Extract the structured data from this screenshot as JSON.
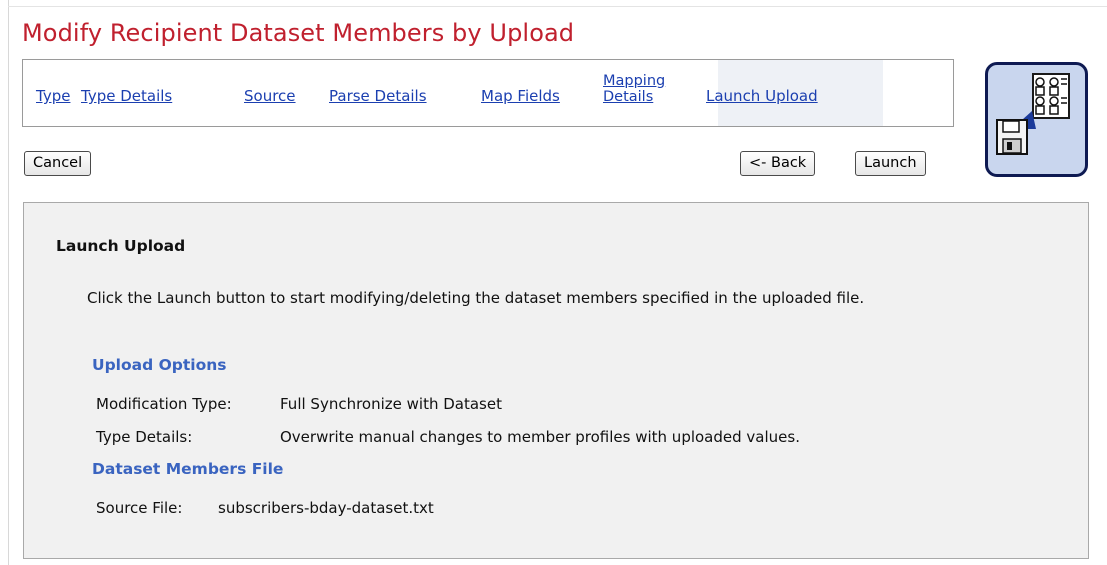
{
  "page": {
    "title": "Modify Recipient Dataset Members by Upload"
  },
  "wizard": {
    "steps": [
      {
        "label": "Type"
      },
      {
        "label": "Type Details"
      },
      {
        "label": "Source"
      },
      {
        "label": "Parse Details"
      },
      {
        "label": "Map Fields"
      },
      {
        "label_line1": "Mapping",
        "label_line2": "Details"
      },
      {
        "label": "Launch Upload",
        "current": true
      }
    ],
    "icon": "upload-members-icon"
  },
  "toolbar": {
    "cancel_label": "Cancel",
    "back_label": "<- Back",
    "launch_label": "Launch"
  },
  "panel": {
    "heading": "Launch Upload",
    "description": "Click the Launch button to start modifying/deleting the dataset members specified in the uploaded file.",
    "upload_options": {
      "title": "Upload Options",
      "modification_type_label": "Modification Type:",
      "modification_type_value": "Full Synchronize with Dataset",
      "type_details_label": "Type Details:",
      "type_details_value": "Overwrite manual changes to member profiles with uploaded values."
    },
    "members_file": {
      "title": "Dataset Members File",
      "source_file_label": "Source File:",
      "source_file_value": "subscribers-bday-dataset.txt"
    }
  },
  "colors": {
    "title": "#c0202e",
    "link": "#1b3fb0",
    "section_title": "#3a64c0",
    "panel_bg": "#f1f1f1",
    "icon_border": "#0e1a52",
    "icon_bg": "#c9d6ee"
  }
}
